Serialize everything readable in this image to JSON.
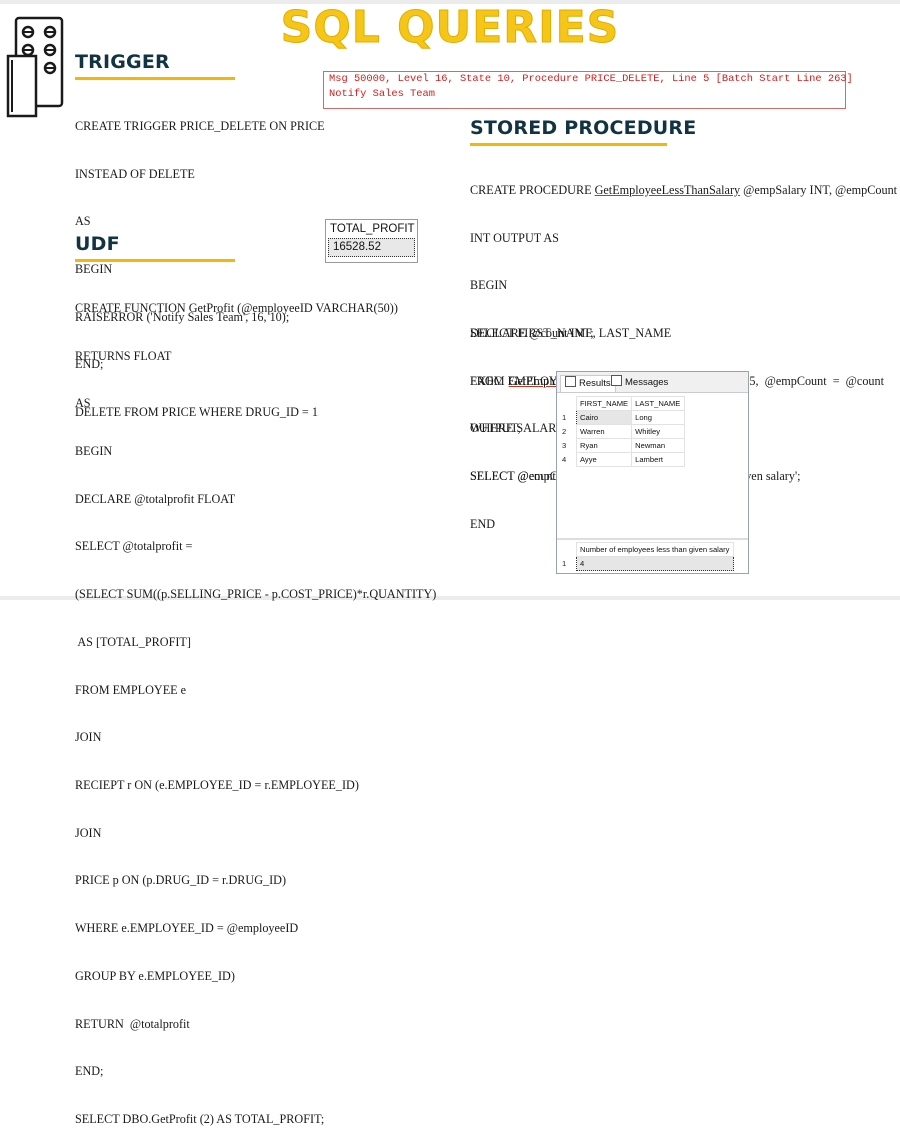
{
  "title": "SQL QUERIES",
  "trigger": {
    "heading": "TRIGGER",
    "code": [
      "CREATE TRIGGER PRICE_DELETE ON PRICE",
      "INSTEAD OF DELETE",
      "AS",
      "BEGIN",
      "RAISERROR ('Notify Sales Team', 16, 10);",
      "END;",
      "DELETE FROM PRICE WHERE DRUG_ID = 1"
    ]
  },
  "error_message": [
    "Msg 50000, Level 16, State 10, Procedure PRICE_DELETE, Line 5 [Batch Start Line 263]",
    "Notify Sales Team"
  ],
  "udf": {
    "heading": "UDF",
    "result": {
      "column": "TOTAL_PROFIT",
      "value": "16528.52"
    },
    "code": [
      "CREATE FUNCTION GetProfit (@employeeID VARCHAR(50))",
      "RETURNS FLOAT",
      "AS",
      "BEGIN",
      "DECLARE @totalprofit FLOAT",
      "SELECT @totalprofit =",
      "(SELECT SUM((p.SELLING_PRICE - p.COST_PRICE)*r.QUANTITY)",
      " AS [TOTAL_PROFIT]",
      "FROM EMPLOYEE e",
      "JOIN",
      "RECIEPT r ON (e.EMPLOYEE_ID = r.EMPLOYEE_ID)",
      "JOIN",
      "PRICE p ON (p.DRUG_ID = r.DRUG_ID)",
      "WHERE e.EMPLOYEE_ID = @employeeID",
      "GROUP BY e.EMPLOYEE_ID)",
      "RETURN  @totalprofit",
      "END;",
      "SELECT DBO.GetProfit (2) AS TOTAL_PROFIT;"
    ]
  },
  "stored_procedure": {
    "heading": "STORED PROCEDURE",
    "code1": {
      "l1_pre": "CREATE PROCEDURE ",
      "l1_proc": "GetEmployeeLessThanSalary",
      "l1_post": " @empSalary INT, @empCount",
      "rest": [
        "INT OUTPUT AS",
        "BEGIN",
        "SELECT FIRST_NAME, LAST_NAME",
        "FROM EMPLOYEE",
        "WHERE SALARY < @empSalary;",
        "SELECT @empCount = @@ROWCOUNT;",
        "END"
      ]
    },
    "code2": {
      "declare": "DECLARE @count INT;",
      "exec_kw": "EXEC",
      "exec_proc": "GetEmployeeLessThanSalary",
      "exec_args": "@empSalary  =  25,  @empCount  =  @count",
      "output": "OUTPUT;",
      "select": "SELECT @count AS 'Number of employees less than given salary';"
    }
  },
  "results_pane": {
    "tabs": [
      "Results",
      "Messages"
    ],
    "columns": [
      "FIRST_NAME",
      "LAST_NAME"
    ],
    "rows": [
      {
        "n": "1",
        "first": "Cairo",
        "last": "Long"
      },
      {
        "n": "2",
        "first": "Warren",
        "last": "Whitley"
      },
      {
        "n": "3",
        "first": "Ryan",
        "last": "Newman"
      },
      {
        "n": "4",
        "first": "Ayye",
        "last": "Lambert"
      }
    ],
    "count_column": "Number of employees less than given salary",
    "count_row": {
      "n": "1",
      "value": "4"
    }
  }
}
